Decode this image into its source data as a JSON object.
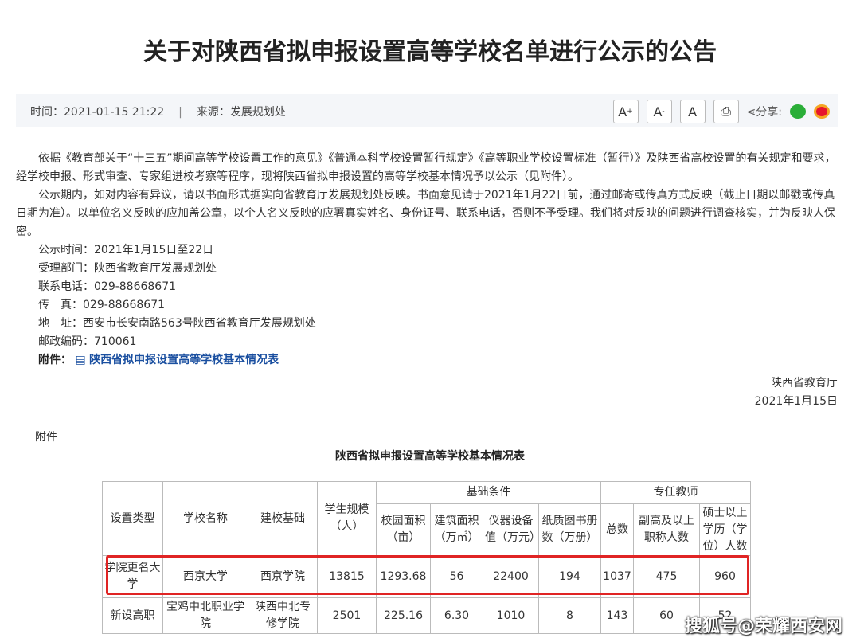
{
  "title": "关于对陕西省拟申报设置高等学校名单进行公示的公告",
  "meta": {
    "time_label": "时间：",
    "time": "2021-01-15 21:22",
    "sep": "|",
    "source_label": "来源：",
    "source": "发展规划处",
    "share": "分享:",
    "font_up": "A",
    "font_down": "A",
    "font_reset": "A"
  },
  "body": {
    "p1": "依据《教育部关于“十三五”期间高等学校设置工作的意见》《普通本科学校设置暂行规定》《高等职业学校设置标准（暂行）》及陕西省高校设置的有关规定和要求，经学校申报、形式审查、专家组进校考察等程序，现将陕西省拟申报设置的高等学校基本情况予以公示（见附件）。",
    "p2": "公示期内，如对内容有异议，请以书面形式据实向省教育厅发展规划处反映。书面意见请于2021年1月22日前，通过邮寄或传真方式反映（截止日期以邮戳或传真日期为准）。以单位名义反映的应加盖公章，以个人名义反映的应署真实姓名、身份证号、联系电话，否则不予受理。我们将对反映的问题进行调查核实，并为反映人保密。",
    "lines": [
      "公示时间：2021年1月15日至22日",
      "受理部门：陕西省教育厅发展规划处",
      "联系电话：029-88668671",
      "传　真：029-88668671",
      "地　址：西安市长安南路563号陕西省教育厅发展规划处",
      "邮政编码：710061"
    ],
    "attach_label": "附件：",
    "attach_link": "陕西省拟申报设置高等学校基本情况表",
    "sign_org": "陕西省教育厅",
    "sign_date": "2021年1月15日"
  },
  "annex_label": "附件",
  "table": {
    "title": "陕西省拟申报设置高等学校基本情况表",
    "h_type": "设置类型",
    "h_name": "学校名称",
    "h_base": "建校基础",
    "h_students": "学生规模（人）",
    "h_group1": "基础条件",
    "h_group2": "专任教师",
    "sub": [
      "校园面积（亩）",
      "建筑面积（万㎡）",
      "仪器设备值（万元）",
      "纸质图书册数（万册）",
      "总数",
      "副高及以上职称人数",
      "硕士以上学历（学位）人数"
    ],
    "rows": [
      [
        "学院更名大学",
        "西京大学",
        "西京学院",
        "13815",
        "1293.68",
        "56",
        "22400",
        "194",
        "1037",
        "475",
        "960"
      ],
      [
        "新设高职",
        "宝鸡中北职业学院",
        "陕西中北专修学院",
        "2501",
        "225.16",
        "6.30",
        "1010",
        "8",
        "143",
        "60",
        "52"
      ]
    ]
  },
  "watermark": "搜狐号@荣耀西安网"
}
